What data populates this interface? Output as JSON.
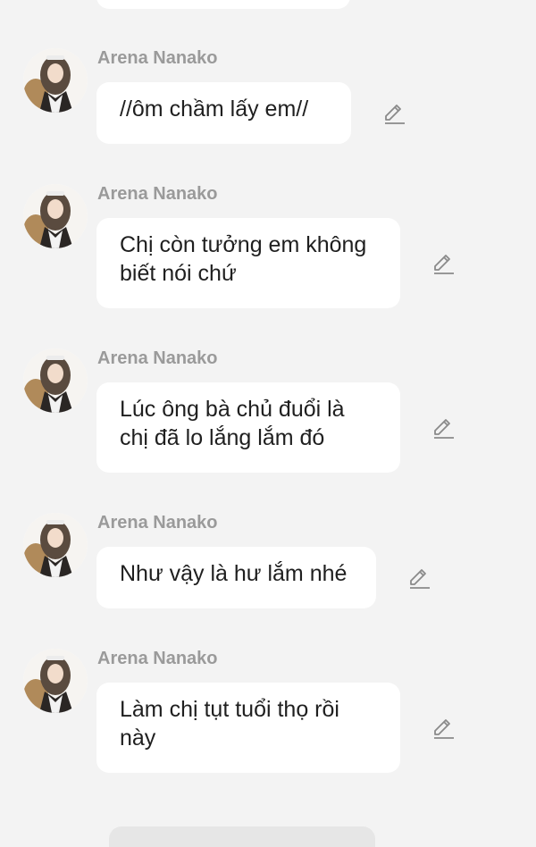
{
  "messages": [
    {
      "sender": "Arena Nanako",
      "text": "//ôm chầm lấy em//",
      "edit_icon": "pencil-icon"
    },
    {
      "sender": "Arena Nanako",
      "text": "Chị còn tưởng em không biết nói chứ",
      "edit_icon": "pencil-icon"
    },
    {
      "sender": "Arena Nanako",
      "text": "Lúc ông bà chủ đuổi là chị đã lo lắng lắm đó",
      "edit_icon": "pencil-icon"
    },
    {
      "sender": "Arena Nanako",
      "text": "Như vậy là hư lắm nhé",
      "edit_icon": "pencil-icon"
    },
    {
      "sender": "Arena Nanako",
      "text": "Làm chị tụt tuổi thọ rồi này",
      "edit_icon": "pencil-icon"
    }
  ],
  "colors": {
    "background": "#f3f3f3",
    "bubble": "#ffffff",
    "sender_name": "#9a9a9a",
    "message_text": "#1f1f1f",
    "icon": "#8a8a8a"
  }
}
